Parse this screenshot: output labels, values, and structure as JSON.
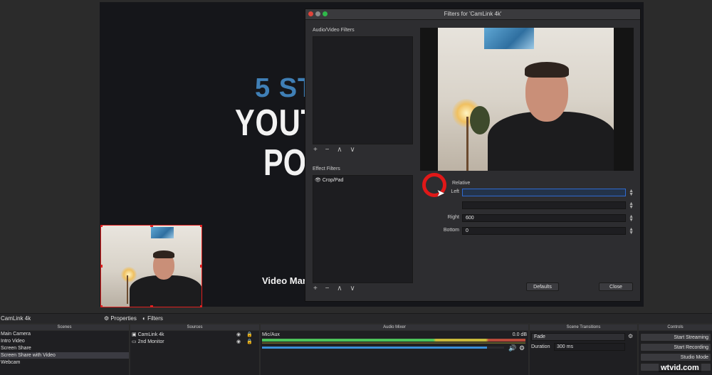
{
  "preview": {
    "line1": "5 ST",
    "line2": "YOUT",
    "line3": "PO",
    "line4": "Video Mar"
  },
  "dialog": {
    "title": "Filters for 'CamLink 4k'",
    "av_filters_label": "Audio/Video Filters",
    "effect_filters_label": "Effect Filters",
    "effect_items": [
      "Crop/Pad"
    ],
    "relative_label": "Relative",
    "props": [
      {
        "label": "Left",
        "value": ""
      },
      {
        "label": "",
        "value": ""
      },
      {
        "label": "Right",
        "value": "600"
      },
      {
        "label": "Bottom",
        "value": "0"
      }
    ],
    "defaults_button": "Defaults",
    "close_button": "Close",
    "tool_icons": "+ − ∧ ∨"
  },
  "bottom": {
    "source_name": "CamLink 4k",
    "properties_button": "Properties",
    "filters_button": "Filters",
    "scenes_header": "Scenes",
    "scenes": [
      "Main Camera",
      "Intro Video",
      "Screen Share",
      "Screen Share with Video",
      "Webcam"
    ],
    "sources_header": "Sources",
    "sources": [
      "CamLink 4k",
      "2nd Monitor"
    ],
    "mixer_header": "Audio Mixer",
    "mixer_channel": "Mic/Aux",
    "mixer_db": "0.0 dB",
    "mixer_volume": 0.93,
    "transitions_header": "Scene Transitions",
    "transition": "Fade",
    "duration_label": "Duration",
    "duration_value": "300 ms",
    "controls_header": "Controls",
    "controls": [
      "Start Streaming",
      "Start Recording",
      "Studio Mode"
    ]
  },
  "watermark": "wtvid.com",
  "colors": {
    "accent_red": "#e02020",
    "slide_blue": "#3f7fb6",
    "meter_green": "#4cc35a",
    "focus_blue": "#2f6ad0"
  }
}
